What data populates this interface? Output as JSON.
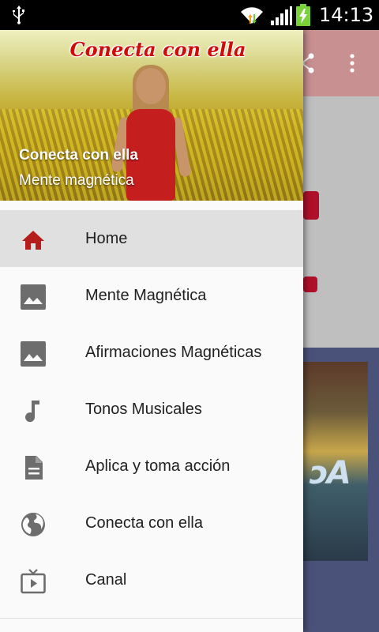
{
  "status_bar": {
    "time": "14:13",
    "icons": [
      "usb-icon",
      "wifi-icon",
      "signal-icon",
      "battery-charging-icon"
    ]
  },
  "background_app": {
    "toolbar_icons": [
      "share-icon",
      "more-vert-icon"
    ]
  },
  "drawer": {
    "header": {
      "logo_text": "Conecta con ella",
      "title": "Conecta con ella",
      "subtitle": "Mente magnética"
    },
    "items": [
      {
        "label": "Home",
        "icon": "home-icon",
        "active": true
      },
      {
        "label": "Mente Magnética",
        "icon": "image-icon",
        "active": false
      },
      {
        "label": "Afirmaciones Magnéticas",
        "icon": "image-icon",
        "active": false
      },
      {
        "label": "Tonos Musicales",
        "icon": "music-note-icon",
        "active": false
      },
      {
        "label": "Aplica y toma acción",
        "icon": "document-icon",
        "active": false
      },
      {
        "label": "Conecta con ella",
        "icon": "globe-icon",
        "active": false
      },
      {
        "label": "Canal",
        "icon": "tv-icon",
        "active": false
      }
    ]
  },
  "colors": {
    "active_icon": "#b71c1c",
    "icon_grey": "#6d6d6d",
    "active_row": "#e0e0e0",
    "logo_red": "#d10a0a",
    "toolbar_pink": "#c89090",
    "bg_navy": "#4a5279"
  }
}
